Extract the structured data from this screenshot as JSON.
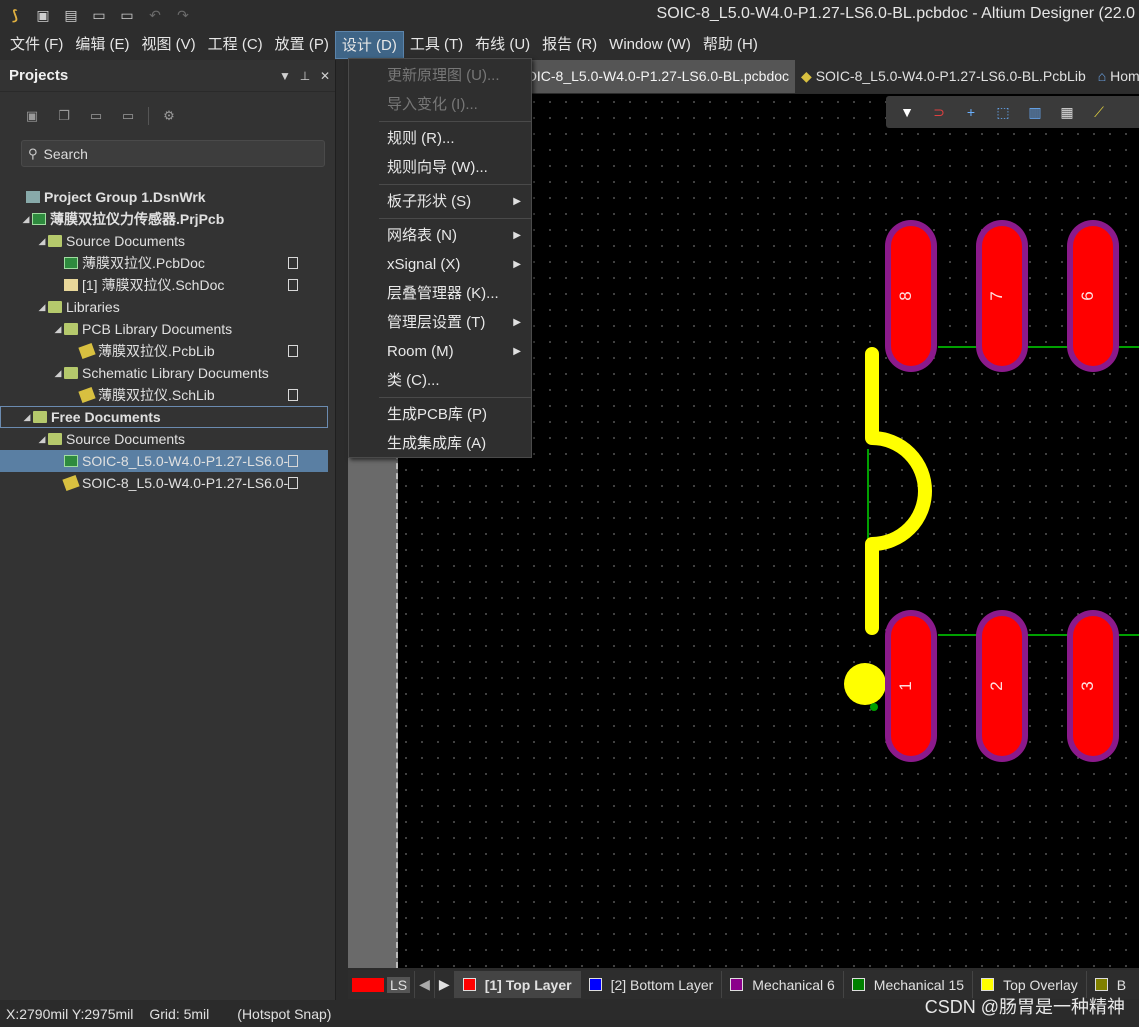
{
  "window": {
    "title": "SOIC-8_L5.0-W4.0-P1.27-LS6.0-BL.pcbdoc - Altium Designer (22.0"
  },
  "menubar": {
    "items": [
      "文件 (F)",
      "编辑 (E)",
      "视图 (V)",
      "工程 (C)",
      "放置 (P)",
      "设计 (D)",
      "工具 (T)",
      "布线 (U)",
      "报告 (R)",
      "Window (W)",
      "帮助 (H)"
    ]
  },
  "projects_panel": {
    "title": "Projects",
    "search_placeholder": "Search",
    "tree": {
      "group": "Project Group 1.DsnWrk",
      "project": "薄膜双拉仪力传感器.PrjPcb",
      "source_docs": "Source Documents",
      "pcbdoc": "薄膜双拉仪.PcbDoc",
      "schdoc": "[1] 薄膜双拉仪.SchDoc",
      "libraries": "Libraries",
      "pcb_lib_docs": "PCB Library Documents",
      "pcblib": "薄膜双拉仪.PcbLib",
      "sch_lib_docs": "Schematic Library Documents",
      "schlib": "薄膜双拉仪.SchLib",
      "free_docs": "Free Documents",
      "free_source_docs": "Source Documents",
      "free_pcbdoc": "SOIC-8_L5.0-W4.0-P1.27-LS6.0-",
      "free_pcblib": "SOIC-8_L5.0-W4.0-P1.27-LS6.0-"
    }
  },
  "tabs": {
    "items": [
      "OIC-8_L5.0-W4.0-P1.27-LS6.0-BL.pcbdoc",
      "SOIC-8_L5.0-W4.0-P1.27-LS6.0-BL.PcbLib",
      "Home"
    ]
  },
  "design_menu": {
    "update_schematic": "更新原理图 (U)...",
    "import_changes": "导入变化 (I)...",
    "rules": "规则 (R)...",
    "rules_wizard": "规则向导 (W)...",
    "board_shape": "板子形状 (S)",
    "netlist": "网络表 (N)",
    "xsignal": "xSignal (X)",
    "layer_stack": "层叠管理器 (K)...",
    "layer_sets": "管理层设置 (T)",
    "room": "Room (M)",
    "classes": "类 (C)...",
    "make_pcb_lib": "生成PCB库 (P)",
    "make_int_lib": "生成集成库 (A)"
  },
  "pcb": {
    "pads_top": [
      "8",
      "7",
      "6"
    ],
    "pads_bottom": [
      "1",
      "2",
      "3"
    ],
    "pad_color": "#ff0000",
    "pad_ring_color": "#8b1a8b",
    "silkscreen_color": "#ffff00",
    "trace_color": "#00a000"
  },
  "layerbar": {
    "ls": "LS",
    "layers": [
      {
        "name": "[1] Top Layer",
        "color": "#ff0000"
      },
      {
        "name": "[2] Bottom Layer",
        "color": "#0000ff"
      },
      {
        "name": "Mechanical 6",
        "color": "#8b008b"
      },
      {
        "name": "Mechanical 15",
        "color": "#008000"
      },
      {
        "name": "Top Overlay",
        "color": "#ffff00"
      },
      {
        "name": "B",
        "color": "#808000"
      }
    ]
  },
  "statusbar": {
    "coords": "X:2790mil Y:2975mil",
    "grid": "Grid: 5mil",
    "snap": "(Hotspot Snap)"
  },
  "watermark": "CSDN @肠胃是一种精神"
}
